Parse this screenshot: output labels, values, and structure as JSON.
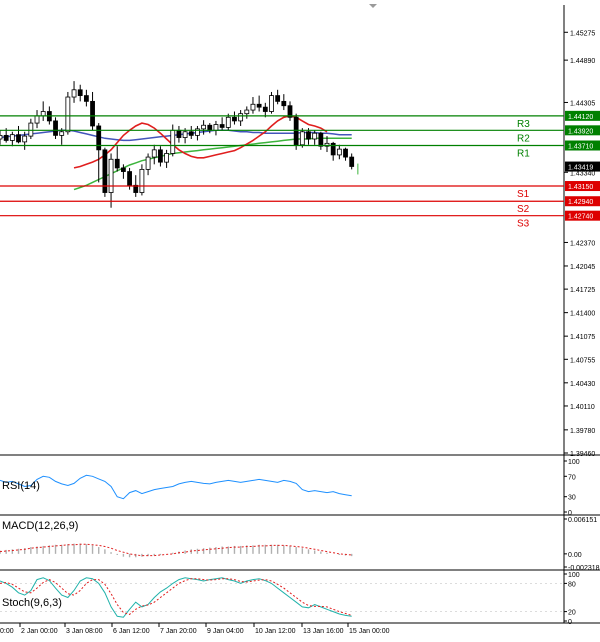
{
  "chart_data": [
    {
      "type": "candlestick",
      "panel": "price",
      "y_ticks": [
        "1.45275",
        "1.44890",
        "1.44305",
        "1.43340",
        "1.42370",
        "1.42045",
        "1.41725",
        "1.41400",
        "1.41075",
        "1.40755",
        "1.40430",
        "1.40110",
        "1.39780",
        "1.39460"
      ],
      "ylim": [
        1.3946,
        1.455
      ],
      "x_ticks": [
        "2 Jan 00:00",
        "3 Jan 08:00",
        "6 Jan 12:00",
        "7 Jan 20:00",
        "9 Jan 04:00",
        "10 Jan 12:00",
        "13 Jan 16:00",
        "15 Jan 00:00"
      ],
      "x_tick_partial_left": "0:00",
      "current_price": "1.43419",
      "levels": [
        {
          "label": "R3",
          "value": "1.44120",
          "color": "#008000"
        },
        {
          "label": "R2",
          "value": "1.43920",
          "color": "#008000"
        },
        {
          "label": "R1",
          "value": "1.43710",
          "color": "#008000"
        },
        {
          "label": "S1",
          "value": "1.43150",
          "color": "#dd0000"
        },
        {
          "label": "S2",
          "value": "1.42940",
          "color": "#dd0000"
        },
        {
          "label": "S3",
          "value": "1.42740",
          "color": "#dd0000"
        }
      ],
      "candles": [
        {
          "o": 1.438,
          "h": 1.4392,
          "l": 1.4372,
          "c": 1.4385
        },
        {
          "o": 1.4385,
          "h": 1.4395,
          "l": 1.4375,
          "c": 1.4378
        },
        {
          "o": 1.4378,
          "h": 1.439,
          "l": 1.437,
          "c": 1.4386
        },
        {
          "o": 1.4386,
          "h": 1.4398,
          "l": 1.4374,
          "c": 1.4376
        },
        {
          "o": 1.4376,
          "h": 1.439,
          "l": 1.4365,
          "c": 1.4384
        },
        {
          "o": 1.4384,
          "h": 1.4408,
          "l": 1.438,
          "c": 1.4402
        },
        {
          "o": 1.4402,
          "h": 1.442,
          "l": 1.4395,
          "c": 1.4412
        },
        {
          "o": 1.4412,
          "h": 1.4432,
          "l": 1.4405,
          "c": 1.4418
        },
        {
          "o": 1.4418,
          "h": 1.4425,
          "l": 1.44,
          "c": 1.4405
        },
        {
          "o": 1.4405,
          "h": 1.441,
          "l": 1.438,
          "c": 1.4385
        },
        {
          "o": 1.4385,
          "h": 1.4395,
          "l": 1.4372,
          "c": 1.439
        },
        {
          "o": 1.439,
          "h": 1.4445,
          "l": 1.4386,
          "c": 1.4438
        },
        {
          "o": 1.4438,
          "h": 1.446,
          "l": 1.443,
          "c": 1.4448
        },
        {
          "o": 1.4448,
          "h": 1.4455,
          "l": 1.4432,
          "c": 1.444
        },
        {
          "o": 1.444,
          "h": 1.4448,
          "l": 1.4425,
          "c": 1.4432
        },
        {
          "o": 1.4432,
          "h": 1.4445,
          "l": 1.4392,
          "c": 1.4398
        },
        {
          "o": 1.4398,
          "h": 1.4402,
          "l": 1.432,
          "c": 1.4365
        },
        {
          "o": 1.4365,
          "h": 1.4368,
          "l": 1.43,
          "c": 1.4306
        },
        {
          "o": 1.4306,
          "h": 1.436,
          "l": 1.4285,
          "c": 1.4352
        },
        {
          "o": 1.4352,
          "h": 1.437,
          "l": 1.4335,
          "c": 1.434
        },
        {
          "o": 1.434,
          "h": 1.4345,
          "l": 1.4325,
          "c": 1.4335
        },
        {
          "o": 1.4335,
          "h": 1.434,
          "l": 1.431,
          "c": 1.4316
        },
        {
          "o": 1.4316,
          "h": 1.433,
          "l": 1.43,
          "c": 1.4306
        },
        {
          "o": 1.4306,
          "h": 1.4345,
          "l": 1.4302,
          "c": 1.4338
        },
        {
          "o": 1.4338,
          "h": 1.436,
          "l": 1.433,
          "c": 1.4355
        },
        {
          "o": 1.4355,
          "h": 1.4372,
          "l": 1.4345,
          "c": 1.4365
        },
        {
          "o": 1.4365,
          "h": 1.437,
          "l": 1.4342,
          "c": 1.4348
        },
        {
          "o": 1.4348,
          "h": 1.4365,
          "l": 1.434,
          "c": 1.436
        },
        {
          "o": 1.436,
          "h": 1.44,
          "l": 1.4356,
          "c": 1.4392
        },
        {
          "o": 1.4392,
          "h": 1.4398,
          "l": 1.4375,
          "c": 1.4382
        },
        {
          "o": 1.4382,
          "h": 1.4395,
          "l": 1.4374,
          "c": 1.439
        },
        {
          "o": 1.439,
          "h": 1.4398,
          "l": 1.438,
          "c": 1.4385
        },
        {
          "o": 1.4385,
          "h": 1.4398,
          "l": 1.4378,
          "c": 1.4394
        },
        {
          "o": 1.4394,
          "h": 1.4406,
          "l": 1.4386,
          "c": 1.4399
        },
        {
          "o": 1.4399,
          "h": 1.4402,
          "l": 1.4388,
          "c": 1.4392
        },
        {
          "o": 1.4392,
          "h": 1.4405,
          "l": 1.4385,
          "c": 1.44
        },
        {
          "o": 1.44,
          "h": 1.441,
          "l": 1.4392,
          "c": 1.4396
        },
        {
          "o": 1.4396,
          "h": 1.4415,
          "l": 1.4392,
          "c": 1.441
        },
        {
          "o": 1.441,
          "h": 1.4418,
          "l": 1.44,
          "c": 1.4405
        },
        {
          "o": 1.4405,
          "h": 1.442,
          "l": 1.4398,
          "c": 1.4415
        },
        {
          "o": 1.4415,
          "h": 1.4425,
          "l": 1.4408,
          "c": 1.442
        },
        {
          "o": 1.442,
          "h": 1.4438,
          "l": 1.4415,
          "c": 1.4428
        },
        {
          "o": 1.4428,
          "h": 1.444,
          "l": 1.4418,
          "c": 1.4424
        },
        {
          "o": 1.4424,
          "h": 1.443,
          "l": 1.441,
          "c": 1.4418
        },
        {
          "o": 1.4418,
          "h": 1.4445,
          "l": 1.4415,
          "c": 1.444
        },
        {
          "o": 1.444,
          "h": 1.4448,
          "l": 1.4428,
          "c": 1.4432
        },
        {
          "o": 1.4432,
          "h": 1.4442,
          "l": 1.442,
          "c": 1.4426
        },
        {
          "o": 1.4426,
          "h": 1.4432,
          "l": 1.4405,
          "c": 1.441
        },
        {
          "o": 1.441,
          "h": 1.4415,
          "l": 1.4365,
          "c": 1.4372
        },
        {
          "o": 1.4372,
          "h": 1.4395,
          "l": 1.4368,
          "c": 1.439
        },
        {
          "o": 1.439,
          "h": 1.4395,
          "l": 1.4372,
          "c": 1.438
        },
        {
          "o": 1.438,
          "h": 1.4392,
          "l": 1.4372,
          "c": 1.4388
        },
        {
          "o": 1.4388,
          "h": 1.439,
          "l": 1.4365,
          "c": 1.437
        },
        {
          "o": 1.437,
          "h": 1.4384,
          "l": 1.4362,
          "c": 1.4374
        },
        {
          "o": 1.4374,
          "h": 1.4376,
          "l": 1.435,
          "c": 1.4358
        },
        {
          "o": 1.4358,
          "h": 1.4372,
          "l": 1.4352,
          "c": 1.4366
        },
        {
          "o": 1.4366,
          "h": 1.4368,
          "l": 1.435,
          "c": 1.4355
        },
        {
          "o": 1.4355,
          "h": 1.436,
          "l": 1.4338,
          "c": 1.4342
        }
      ],
      "ma_red": [
        1.434,
        1.4342,
        1.4345,
        1.4348,
        1.4352,
        1.4358,
        1.4365,
        1.4375,
        1.4385,
        1.4392,
        1.4398,
        1.4402,
        1.44,
        1.4395,
        1.4388,
        1.438,
        1.4372,
        1.4365,
        1.436,
        1.4356,
        1.4354,
        1.4354,
        1.4356,
        1.4358,
        1.436,
        1.4362,
        1.4364,
        1.4368,
        1.4373,
        1.4378,
        1.4384,
        1.439,
        1.4398,
        1.4405,
        1.441,
        1.4412,
        1.441,
        1.4405,
        1.44,
        1.4398,
        1.4395,
        1.439
      ],
      "ma_red_start": 12,
      "ma_blue": [
        1.4382,
        1.4383,
        1.4384,
        1.4385,
        1.4386,
        1.4387,
        1.4388,
        1.4389,
        1.439,
        1.4391,
        1.4392,
        1.4392,
        1.4391,
        1.4389,
        1.4387,
        1.4385,
        1.4383,
        1.4381,
        1.438,
        1.4379,
        1.4378,
        1.4378,
        1.4379,
        1.438,
        1.4381,
        1.4382,
        1.4383,
        1.4384,
        1.4385,
        1.4386,
        1.4387,
        1.4388,
        1.4389,
        1.439,
        1.4391,
        1.4392,
        1.4392,
        1.4392,
        1.4391,
        1.439,
        1.439,
        1.4389,
        1.4389,
        1.4388,
        1.4388,
        1.4388,
        1.4388,
        1.4388,
        1.4388,
        1.4389,
        1.4389,
        1.4389,
        1.4388,
        1.4388,
        1.4387,
        1.4386,
        1.4386,
        1.4386
      ],
      "ma_green": [
        1.431,
        1.4313,
        1.4316,
        1.432,
        1.4324,
        1.4328,
        1.4332,
        1.4336,
        1.434,
        1.4344,
        1.4347,
        1.435,
        1.4352,
        1.4354,
        1.4356,
        1.4358,
        1.436,
        1.4361,
        1.4362,
        1.4363,
        1.4364,
        1.4365,
        1.4366,
        1.4367,
        1.4368,
        1.4369,
        1.437,
        1.4371,
        1.4372,
        1.4373,
        1.4374,
        1.4375,
        1.4376,
        1.4377,
        1.4378,
        1.4379,
        1.438,
        1.438,
        1.438,
        1.4381,
        1.4381,
        1.4381,
        1.4381,
        1.4381,
        1.4381,
        1.4381
      ],
      "ma_green_start": 12
    },
    {
      "type": "line",
      "panel": "rsi",
      "title": "RSI(14)",
      "ylim": [
        0,
        100
      ],
      "y_ticks": [
        "100",
        "70",
        "30",
        "0"
      ],
      "values": [
        62,
        58,
        60,
        55,
        50,
        52,
        64,
        70,
        68,
        60,
        55,
        52,
        56,
        66,
        72,
        70,
        65,
        60,
        50,
        30,
        26,
        38,
        42,
        36,
        40,
        44,
        46,
        48,
        50,
        55,
        58,
        60,
        58,
        56,
        55,
        58,
        60,
        62,
        60,
        58,
        60,
        62,
        64,
        62,
        60,
        58,
        62,
        60,
        56,
        44,
        40,
        42,
        40,
        38,
        40,
        36,
        34,
        32
      ]
    },
    {
      "type": "bar",
      "panel": "macd",
      "title": "MACD(12,26,9)",
      "ylim": [
        -0.002318,
        0.006151
      ],
      "y_ticks": [
        "0.006151",
        "0.00",
        "-0.002318"
      ],
      "histogram": [
        0.0006,
        0.0007,
        0.0008,
        0.0009,
        0.001,
        0.0012,
        0.0013,
        0.0014,
        0.0015,
        0.0016,
        0.0016,
        0.0017,
        0.0018,
        0.0018,
        0.0017,
        0.0015,
        0.0012,
        0.0008,
        0.0003,
        -0.0002,
        -0.0005,
        -0.0006,
        -0.0006,
        -0.0005,
        -0.0004,
        -0.0003,
        -0.0002,
        0.0,
        0.0002,
        0.0004,
        0.0006,
        0.0008,
        0.0009,
        0.001,
        0.0011,
        0.0012,
        0.0013,
        0.0013,
        0.0014,
        0.0014,
        0.0015,
        0.0015,
        0.0016,
        0.0016,
        0.0016,
        0.0016,
        0.0015,
        0.0014,
        0.0012,
        0.001,
        0.0008,
        0.0006,
        0.0004,
        0.0002,
        0.0,
        -0.0002,
        -0.0003,
        -0.0004
      ],
      "signal": [
        0.0004,
        0.0005,
        0.0006,
        0.0007,
        0.0008,
        0.001,
        0.0011,
        0.0012,
        0.0013,
        0.0014,
        0.0015,
        0.0016,
        0.0016,
        0.0017,
        0.0017,
        0.0016,
        0.0015,
        0.0013,
        0.001,
        0.0006,
        0.0003,
        0.0,
        -0.0002,
        -0.0003,
        -0.0003,
        -0.0003,
        -0.0002,
        -0.0001,
        0.0,
        0.0002,
        0.0003,
        0.0005,
        0.0006,
        0.0007,
        0.0008,
        0.0009,
        0.001,
        0.0011,
        0.0012,
        0.0012,
        0.0013,
        0.0013,
        0.0014,
        0.0014,
        0.0015,
        0.0015,
        0.0015,
        0.0014,
        0.0013,
        0.0012,
        0.001,
        0.0008,
        0.0006,
        0.0004,
        0.0002,
        0.0,
        -0.0001,
        -0.0002
      ]
    },
    {
      "type": "line",
      "panel": "stoch",
      "title": "Stoch(9,6,3)",
      "ylim": [
        0,
        100
      ],
      "y_ticks": [
        "100",
        "80",
        "20",
        "0"
      ],
      "k": [
        85,
        80,
        72,
        60,
        55,
        65,
        88,
        92,
        86,
        70,
        55,
        50,
        65,
        85,
        92,
        90,
        80,
        60,
        30,
        10,
        8,
        25,
        40,
        30,
        35,
        50,
        62,
        70,
        80,
        88,
        92,
        90,
        88,
        85,
        88,
        90,
        92,
        88,
        85,
        80,
        85,
        88,
        90,
        86,
        80,
        70,
        60,
        50,
        40,
        30,
        28,
        35,
        30,
        25,
        20,
        15,
        12,
        10
      ],
      "d": [
        80,
        82,
        78,
        70,
        62,
        60,
        70,
        82,
        88,
        82,
        70,
        58,
        55,
        65,
        80,
        88,
        88,
        78,
        58,
        35,
        18,
        14,
        25,
        32,
        34,
        40,
        50,
        60,
        70,
        80,
        86,
        90,
        90,
        88,
        87,
        88,
        90,
        90,
        88,
        84,
        83,
        85,
        87,
        88,
        85,
        78,
        70,
        60,
        50,
        40,
        33,
        31,
        31,
        30,
        25,
        20,
        16,
        12
      ]
    }
  ]
}
